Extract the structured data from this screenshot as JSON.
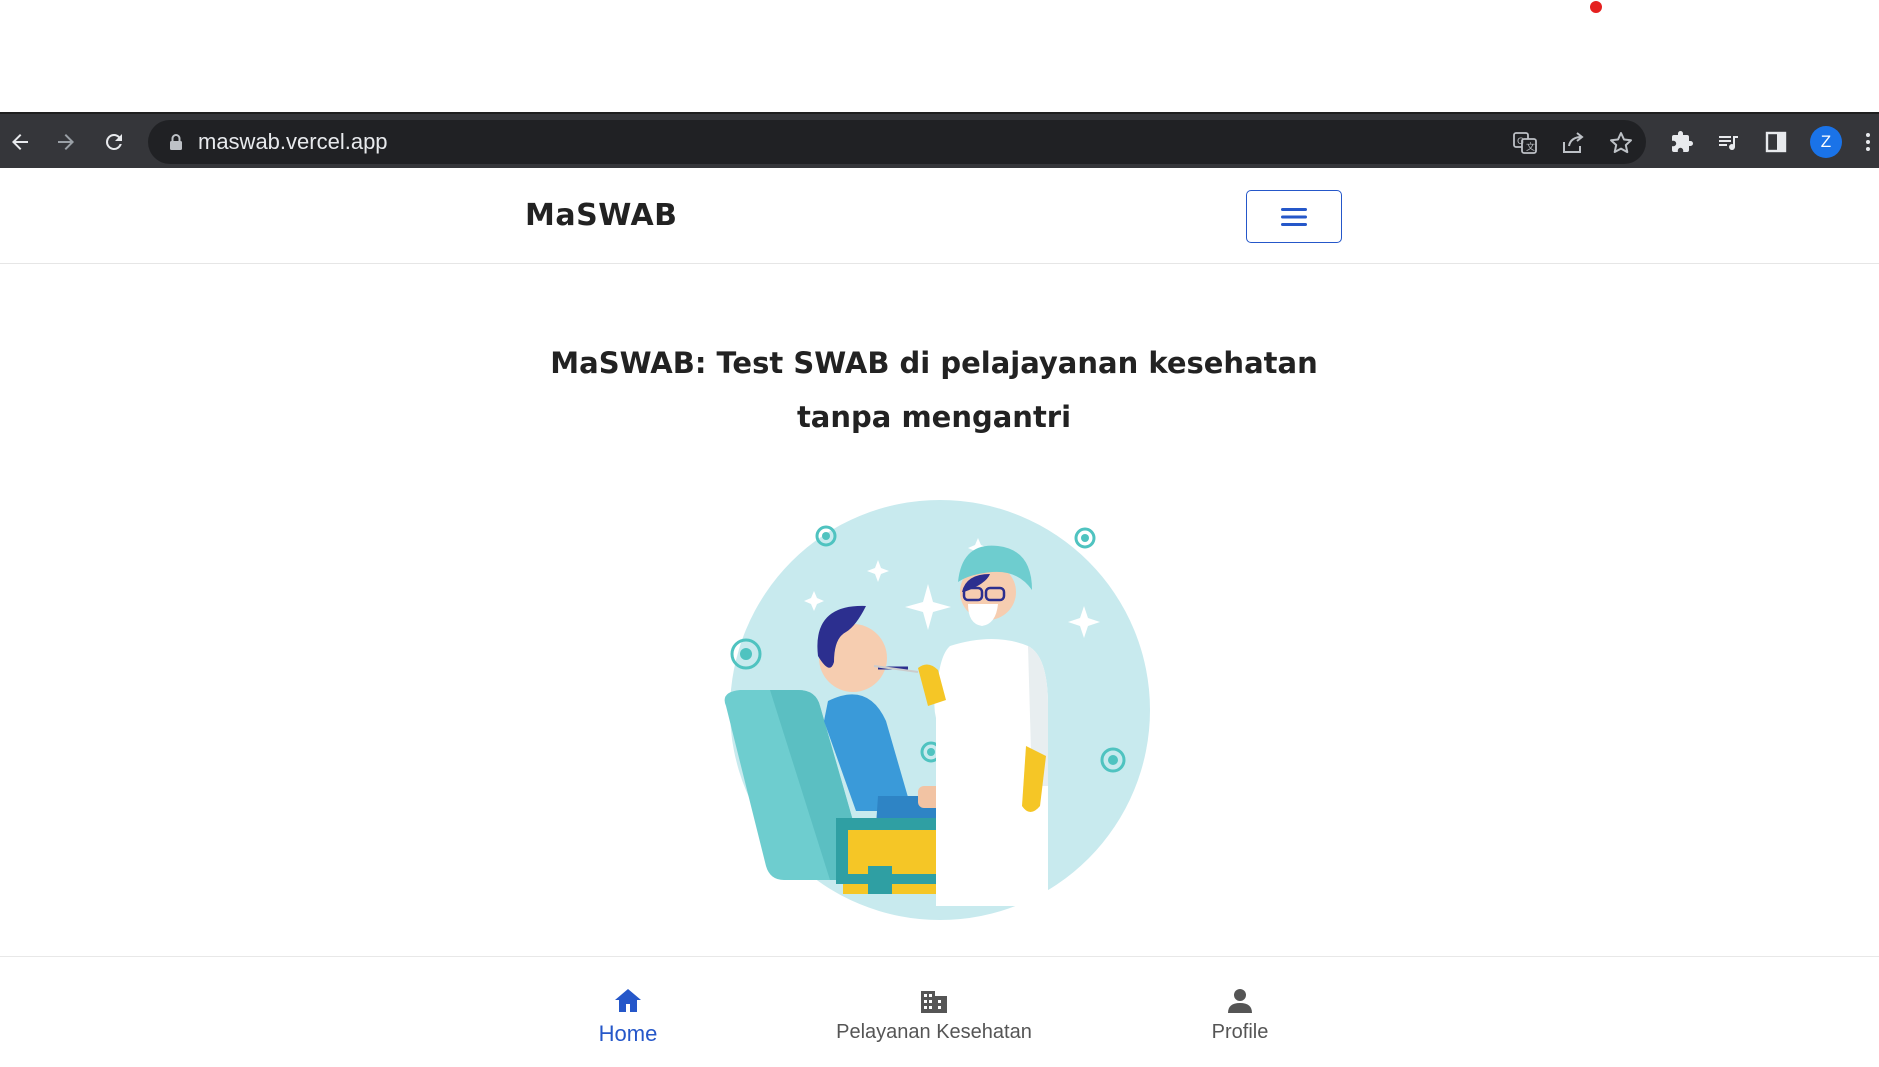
{
  "browser": {
    "url": "maswab.vercel.app",
    "profile_initial": "Z",
    "profile_color": "#1a73e8"
  },
  "header": {
    "brand": "MaSWAB",
    "accent_color": "#2557c9"
  },
  "hero": {
    "title": "MaSWAB: Test SWAB di pelajayanan kesehatan tanpa mengantri",
    "illustration": "swab-test-illustration"
  },
  "bottom_nav": {
    "items": [
      {
        "label": "Home",
        "icon": "home-icon",
        "active": true
      },
      {
        "label": "Pelayanan Kesehatan",
        "icon": "building-icon",
        "active": false
      },
      {
        "label": "Profile",
        "icon": "person-icon",
        "active": false
      }
    ]
  }
}
